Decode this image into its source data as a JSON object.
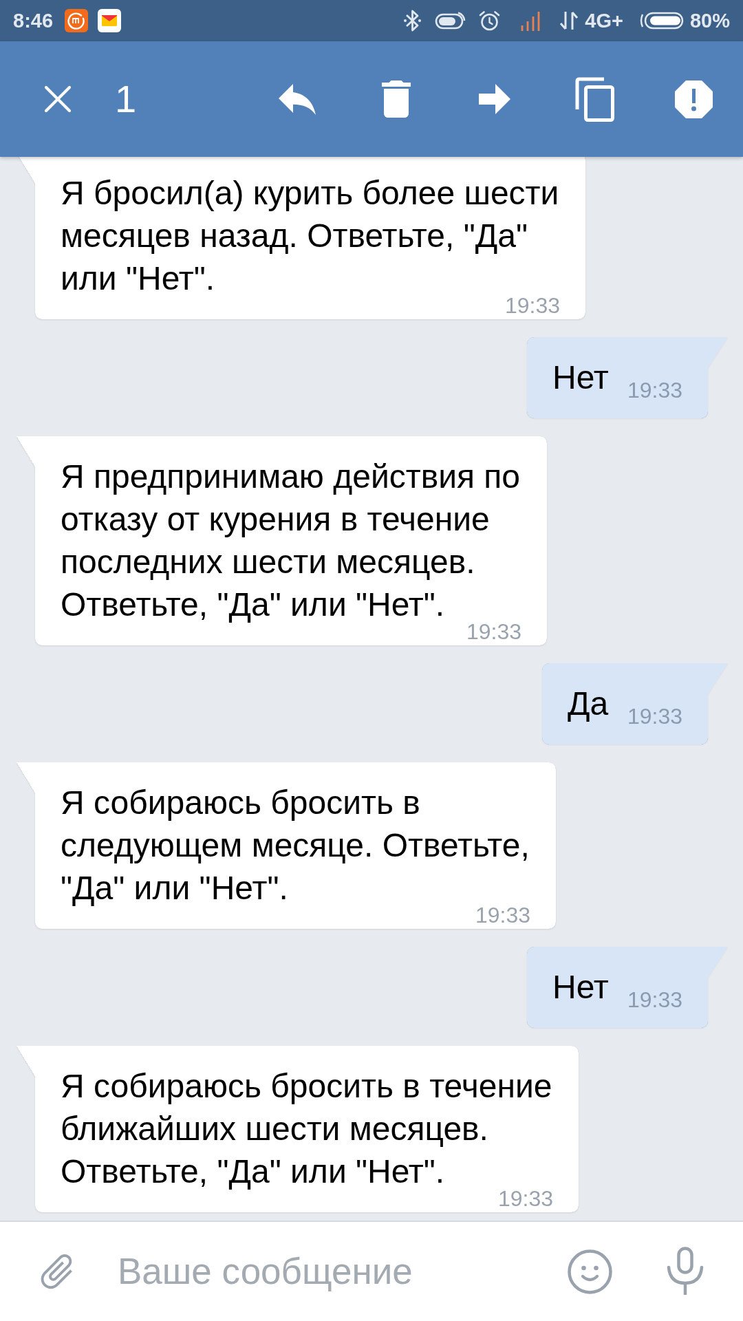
{
  "status_bar": {
    "time": "8:46",
    "network": "4G+",
    "battery": "80%"
  },
  "selection_toolbar": {
    "count": "1"
  },
  "messages": [
    {
      "kind": "incoming",
      "text": "Я бросил(а) курить более шести месяцев назад. Ответьте, \"Да\" или \"Нет\".",
      "time": "19:33"
    },
    {
      "kind": "outgoing",
      "text": "Нет",
      "time": "19:33"
    },
    {
      "kind": "incoming",
      "text": "Я предпринимаю действия по отказу от курения в течение последних шести месяцев. Ответьте, \"Да\" или \"Нет\".",
      "time": "19:33"
    },
    {
      "kind": "outgoing",
      "text": "Да",
      "time": "19:33"
    },
    {
      "kind": "incoming",
      "text": "Я собираюсь бросить в следующем месяце. Ответьте, \"Да\" или \"Нет\".",
      "time": "19:33"
    },
    {
      "kind": "outgoing",
      "text": "Нет",
      "time": "19:33"
    },
    {
      "kind": "incoming",
      "text": "Я собираюсь бросить в течение ближайших шести месяцев. Ответьте, \"Да\" или \"Нет\".",
      "time": "19:33"
    }
  ],
  "composer": {
    "placeholder": "Ваше сообщение"
  }
}
